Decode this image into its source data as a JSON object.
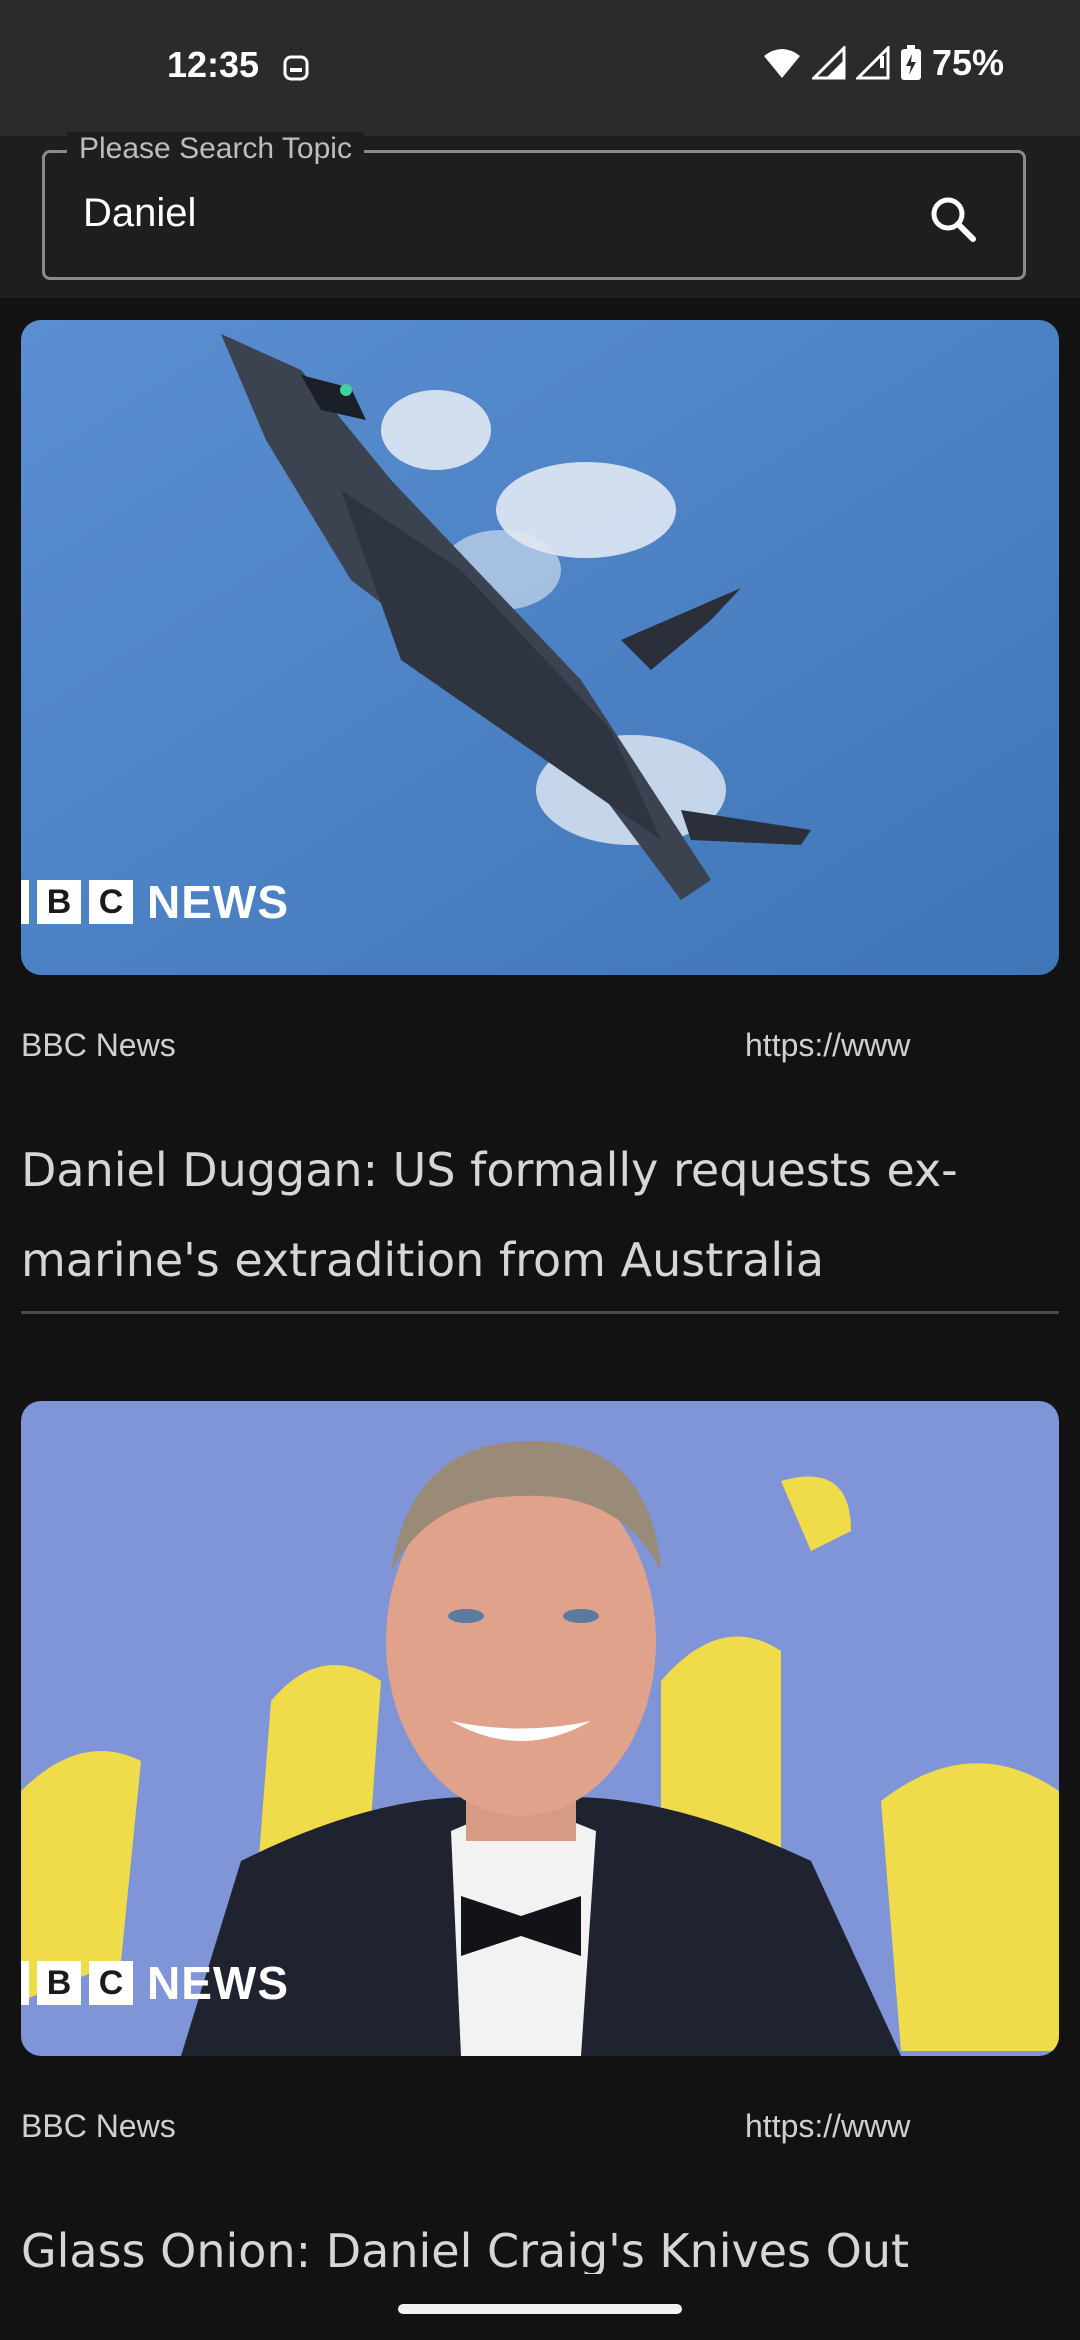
{
  "status_bar": {
    "time": "12:35",
    "battery": "75%",
    "icons": [
      "notification-icon",
      "wifi-icon",
      "signal-icon",
      "signal-empty-icon",
      "battery-charging-icon"
    ]
  },
  "search": {
    "label": "Please Search Topic",
    "value": "Daniel",
    "icon": "search-icon"
  },
  "articles": [
    {
      "source": "BBC News",
      "url": "https://www",
      "headline": "Daniel Duggan: US formally requests ex-marine's extradition from Australia",
      "logo_text": "NEWS",
      "image": "fighter-jet"
    },
    {
      "source": "BBC News",
      "url": "https://www",
      "headline": "Glass Onion: Daniel Craig's Knives Out sequel",
      "logo_text": "NEWS",
      "image": "man-in-tuxedo"
    }
  ],
  "colors": {
    "background": "#121212",
    "status_bar": "#2b2b2b",
    "search_area": "#1e1e1e",
    "sky_blue": "#4d82c4"
  }
}
